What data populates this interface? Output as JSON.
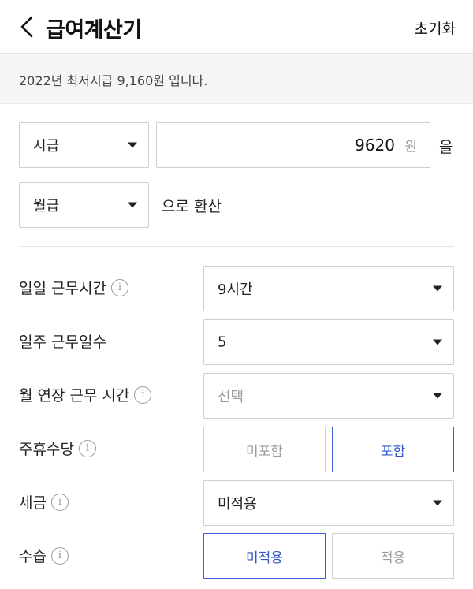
{
  "header": {
    "title": "급여계산기",
    "reset_label": "초기화"
  },
  "notice": {
    "text": "2022년 최저시급 9,160원 입니다."
  },
  "conversion": {
    "from_unit": "시급",
    "amount": "9620",
    "currency": "원",
    "object_particle": "을",
    "to_unit": "월급",
    "suffix": "으로 환산"
  },
  "rows": {
    "daily_hours": {
      "label": "일일 근무시간",
      "value": "9시간"
    },
    "weekly_days": {
      "label": "일주 근무일수",
      "value": "5"
    },
    "monthly_overtime": {
      "label": "월 연장 근무 시간",
      "placeholder": "선택"
    },
    "weekly_holiday_pay": {
      "label": "주휴수당",
      "option_exclude": "미포함",
      "option_include": "포함",
      "selected": "포함"
    },
    "tax": {
      "label": "세금",
      "value": "미적용"
    },
    "probation": {
      "label": "수습",
      "option_not_applied": "미적용",
      "option_applied": "적용",
      "selected": "미적용"
    }
  },
  "info_glyph": "i",
  "colors": {
    "accent": "#3d62d6",
    "notice_bg": "#f5f5f5",
    "border": "#cfcfcf"
  }
}
